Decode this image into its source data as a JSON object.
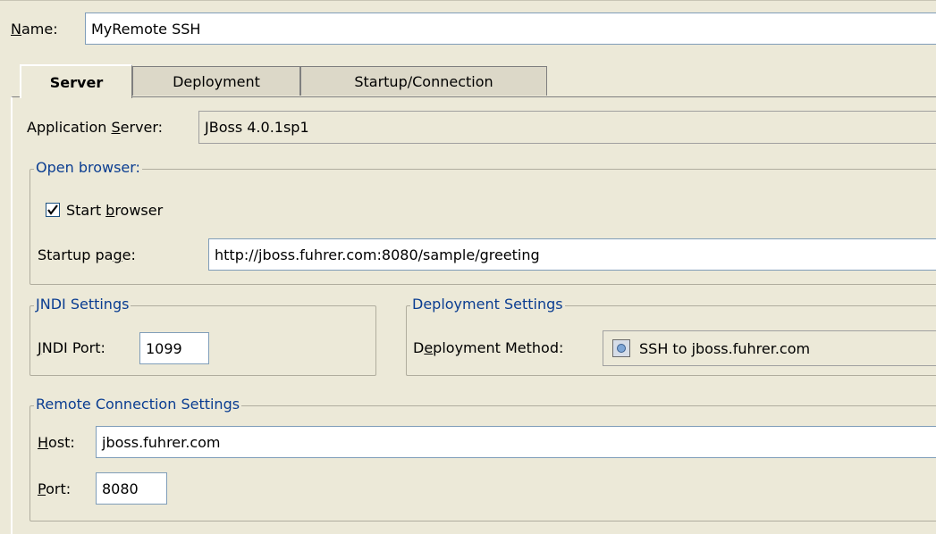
{
  "name": {
    "label_key": "N",
    "label_rest": "ame:",
    "value": "MyRemote SSH"
  },
  "tabs": [
    {
      "label": "Server",
      "active": true
    },
    {
      "label": "Deployment",
      "active": false
    },
    {
      "label": "Startup/Connection",
      "active": false
    }
  ],
  "server": {
    "app_server_label_a": "Application ",
    "app_server_label_key": "S",
    "app_server_label_b": "erver:",
    "app_server_value": "JBoss 4.0.1sp1"
  },
  "open_browser": {
    "title": "Open browser:",
    "start_label_a": "Start ",
    "start_label_key": "b",
    "start_label_b": "rowser",
    "start_checked": true,
    "startup_page_label_a": "Startup pa",
    "startup_page_label_key": "g",
    "startup_page_label_b": "e:",
    "startup_page_value": "http://jboss.fuhrer.com:8080/sample/greeting"
  },
  "jndi": {
    "title": "JNDI Settings",
    "port_label_key": "J",
    "port_label_rest": "NDI Port:",
    "port_value": "1099"
  },
  "deployment": {
    "title": "Deployment Settings",
    "method_label_a": "D",
    "method_label_key": "e",
    "method_label_b": "ployment Method:",
    "method_value": "SSH to jboss.fuhrer.com",
    "method_icon": "server-icon"
  },
  "remote": {
    "title": "Remote Connection Settings",
    "host_label_key": "H",
    "host_label_rest": "ost:",
    "host_value": "jboss.fuhrer.com",
    "port_label_key": "P",
    "port_label_rest": "ort:",
    "port_value": "8080"
  },
  "colors": {
    "background": "#ece9d8",
    "group_title": "#0a3d91",
    "field_border": "#7f9db9"
  }
}
